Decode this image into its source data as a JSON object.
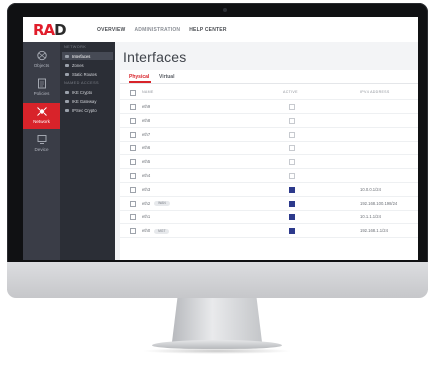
{
  "topnav": {
    "items": [
      {
        "label": "OVERVIEW",
        "muted": false
      },
      {
        "label": "ADMINISTRATION",
        "muted": true
      },
      {
        "label": "HELP CENTER",
        "muted": false
      }
    ]
  },
  "logo": {
    "text_a": "RA",
    "text_b": "D"
  },
  "rail": {
    "items": [
      {
        "label": "Objects",
        "icon": "objects-icon"
      },
      {
        "label": "Policies",
        "icon": "policies-icon"
      },
      {
        "label": "Network",
        "icon": "network-icon",
        "active": true
      },
      {
        "label": "Device",
        "icon": "device-icon"
      }
    ]
  },
  "submenu": {
    "section_network": "NETWORK",
    "section_other": "NAMED ACCESS",
    "network_items": [
      {
        "label": "Interfaces",
        "active": true
      },
      {
        "label": "Zones"
      },
      {
        "label": "Static Routes"
      }
    ],
    "other_items": [
      {
        "label": "IKE Crypto"
      },
      {
        "label": "IKE Gateway"
      },
      {
        "label": "IPSec Crypto"
      }
    ]
  },
  "page": {
    "title": "Interfaces"
  },
  "tabs": {
    "physical": "Physical",
    "virtual": "Virtual"
  },
  "table": {
    "headers": {
      "name": "NAME",
      "active": "ACTIVE",
      "ip": "IPV4 ADDRESS"
    },
    "rows": [
      {
        "name": "eth9",
        "badge": "",
        "active": false,
        "ip": ""
      },
      {
        "name": "eth8",
        "badge": "",
        "active": false,
        "ip": ""
      },
      {
        "name": "eth7",
        "badge": "",
        "active": false,
        "ip": ""
      },
      {
        "name": "eth6",
        "badge": "",
        "active": false,
        "ip": ""
      },
      {
        "name": "eth5",
        "badge": "",
        "active": false,
        "ip": ""
      },
      {
        "name": "eth4",
        "badge": "",
        "active": false,
        "ip": ""
      },
      {
        "name": "eth3",
        "badge": "",
        "active": true,
        "ip": "10.0.0.1/24"
      },
      {
        "name": "eth2",
        "badge": "WAN",
        "active": true,
        "ip": "192.168.100.198/24"
      },
      {
        "name": "eth1",
        "badge": "",
        "active": true,
        "ip": "10.1.1.1/24"
      },
      {
        "name": "eth0",
        "badge": "MGT",
        "active": true,
        "ip": "192.168.1.1/24"
      }
    ]
  },
  "colors": {
    "accent": "#d8232a",
    "rail": "#3a3d47",
    "submenu": "#2b2e36",
    "active_check": "#2d3a8c"
  }
}
